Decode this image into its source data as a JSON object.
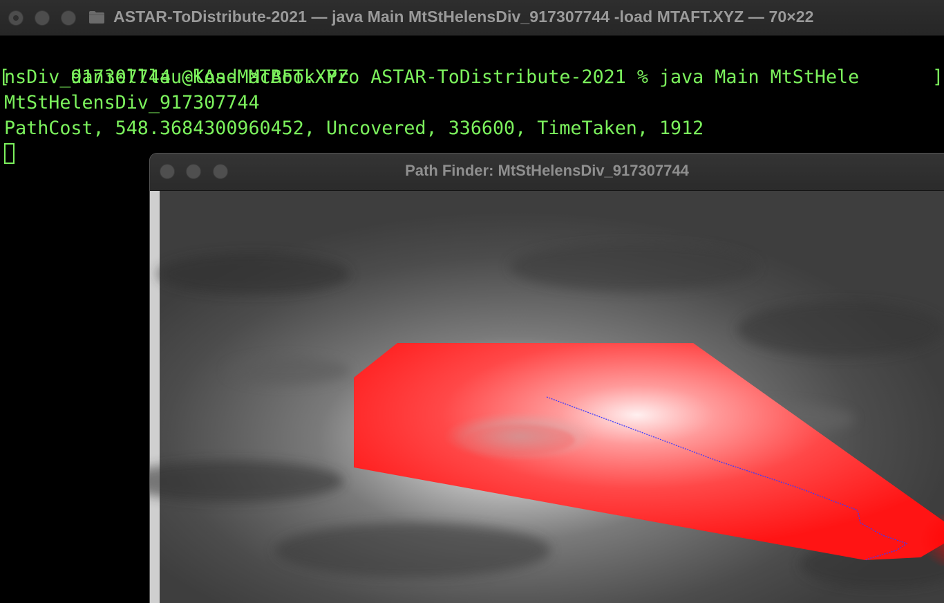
{
  "terminal": {
    "title": "ASTAR-ToDistribute-2021 — java Main MtStHelensDiv_917307744 -load MTAFT.XYZ — 70×22",
    "lines": [
      "danielllau@KAs-MacBook-Pro ASTAR-ToDistribute-2021 % java Main MtStHele",
      "nsDiv_917307744 -load MTAFT.XYZ",
      "MtStHelensDiv_917307744",
      "PathCost, 548.3684300960452, Uncovered, 336600, TimeTaken, 1912"
    ],
    "text_color": "#7cf25d"
  },
  "path_finder": {
    "title": "Path Finder: MtStHelensDiv_917307744",
    "explored_region_color": "#ff2020",
    "path_color": "#3a3aff"
  }
}
